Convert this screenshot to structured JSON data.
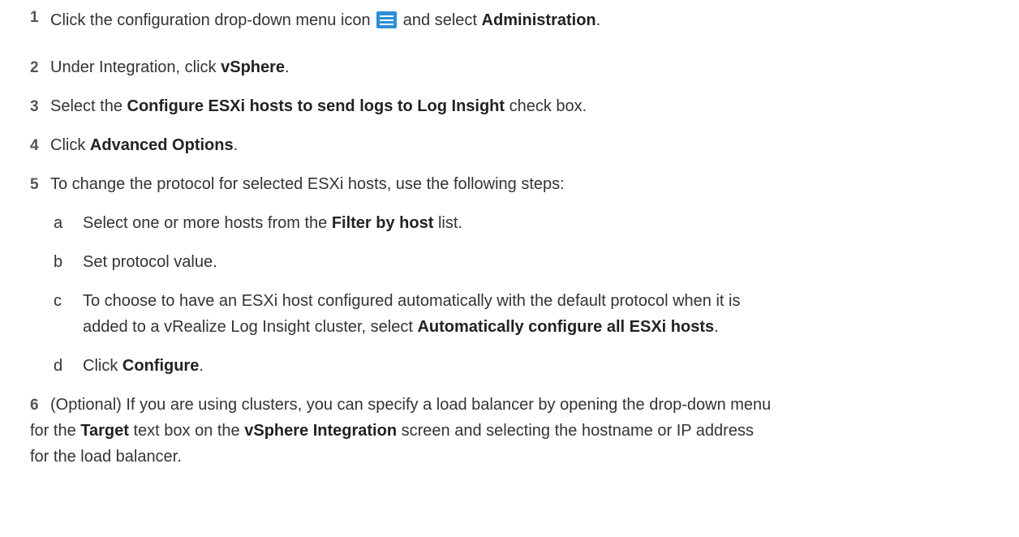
{
  "steps": [
    {
      "num": "1",
      "pre": "Click the configuration drop-down menu icon",
      "icon": "hamburger-menu-icon",
      "mid": "and select",
      "bold": "Administration",
      "post": "."
    },
    {
      "num": "2",
      "pre": "Under Integration, click",
      "bold": "vSphere",
      "post": "."
    },
    {
      "num": "3",
      "pre": "Select the",
      "bold": "Configure ESXi hosts to send logs to Log Insight",
      "post": "check box."
    },
    {
      "num": "4",
      "pre": "Click",
      "bold": "Advanced Options",
      "post": "."
    },
    {
      "num": "5",
      "text": "To change the protocol for selected ESXi hosts, use the following steps:"
    },
    {
      "num": "6",
      "line1": "(Optional) If you are using clusters, you can specify a load balancer by opening the drop-down menu",
      "line2_pre": "for the",
      "line2_bold1": "Target",
      "line2_mid": "text box on the",
      "line2_bold2": "vSphere Integration",
      "line2_post": "screen and selecting the hostname or IP address",
      "line3": "for the load balancer."
    }
  ],
  "substeps": [
    {
      "letter": "a",
      "pre": "Select one or more hosts from the",
      "bold": "Filter by host",
      "post": "list."
    },
    {
      "letter": "b",
      "text": "Set protocol value."
    },
    {
      "letter": "c",
      "line1": "To choose to have an ESXi host configured automatically with the default protocol when it is",
      "line2_pre": "added to a vRealize Log Insight cluster, select",
      "line2_bold": "Automatically configure all ESXi hosts",
      "line2_post": "."
    },
    {
      "letter": "d",
      "pre": "Click",
      "bold": "Configure",
      "post": "."
    }
  ],
  "colors": {
    "icon_blue": "#2e8fd6",
    "text": "#333333"
  }
}
